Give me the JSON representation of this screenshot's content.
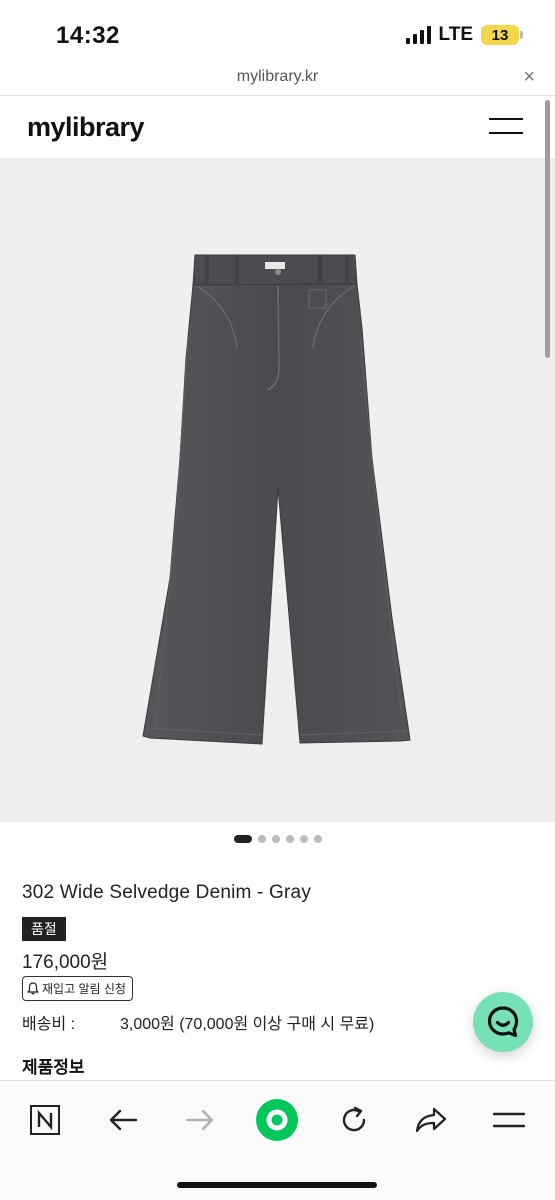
{
  "status_bar": {
    "time": "14:32",
    "network": "LTE",
    "battery": "13"
  },
  "browser": {
    "url": "mylibrary.kr",
    "close_symbol": "×"
  },
  "site": {
    "logo": "mylibrary"
  },
  "carousel": {
    "total": 6,
    "active_index": 0
  },
  "product": {
    "name": "302 Wide Selvedge Denim - Gray",
    "badge": "품절",
    "price": "176,000원",
    "restock_button": "재입고 알림 신청",
    "shipping_label": "배송비 :",
    "shipping_value": "3,000원 (70,000원 이상 구매 시 무료)",
    "info_heading": "제품정보"
  },
  "colors": {
    "chat_button": "#75e1b5",
    "toolbar_green": "#03c75a",
    "battery": "#f2d64b",
    "image_background": "#efefef",
    "denim": "#4a4c50"
  },
  "icons": {
    "toolbar": [
      "naver-n-icon",
      "back-arrow-icon",
      "forward-arrow-icon",
      "green-home-icon",
      "reload-icon",
      "share-icon",
      "menu-icon"
    ],
    "chat": "chat-bubble-icon",
    "bell": "bell-icon"
  }
}
